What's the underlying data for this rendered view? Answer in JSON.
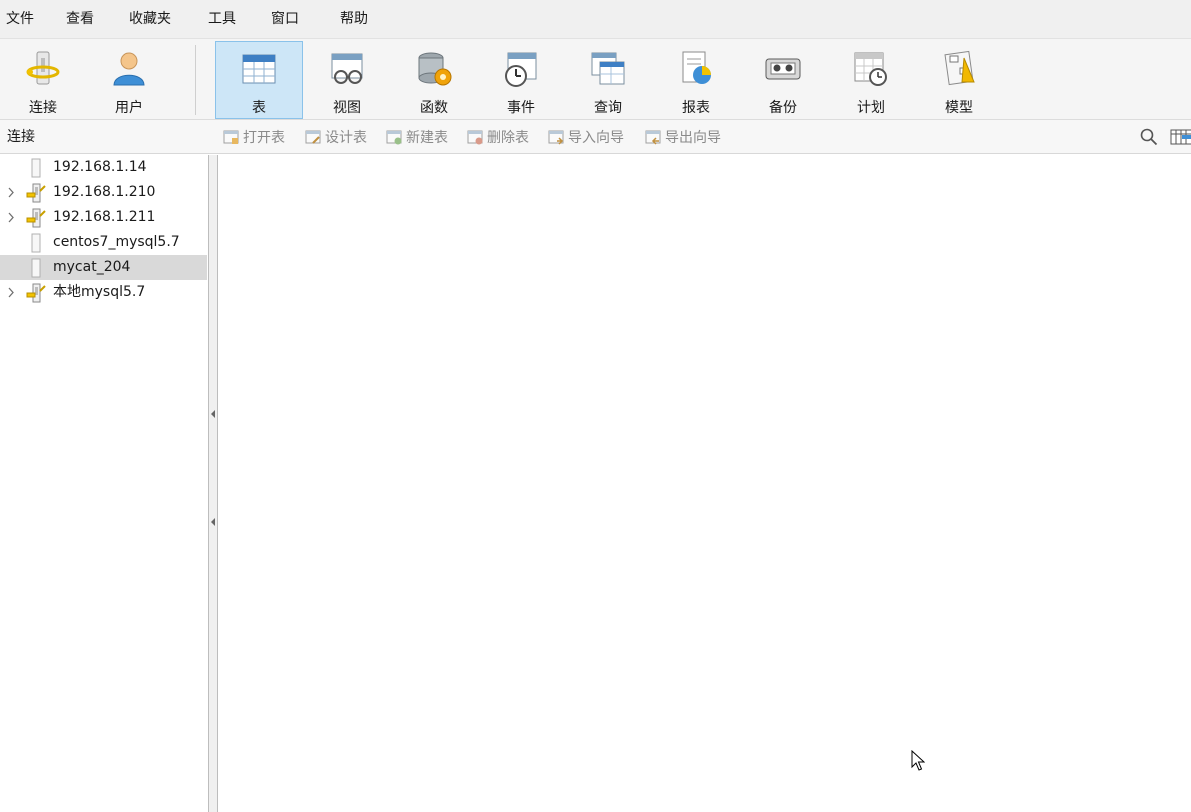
{
  "menu": [
    "文件",
    "查看",
    "收藏夹",
    "工具",
    "窗口",
    "帮助"
  ],
  "toolbar": [
    {
      "label": "连接",
      "icon": "connection-icon"
    },
    {
      "label": "用户",
      "icon": "user-icon"
    },
    {
      "label": "表",
      "icon": "table-icon",
      "active": true
    },
    {
      "label": "视图",
      "icon": "view-icon"
    },
    {
      "label": "函数",
      "icon": "function-icon"
    },
    {
      "label": "事件",
      "icon": "event-icon"
    },
    {
      "label": "查询",
      "icon": "query-icon"
    },
    {
      "label": "报表",
      "icon": "report-icon"
    },
    {
      "label": "备份",
      "icon": "backup-icon"
    },
    {
      "label": "计划",
      "icon": "schedule-icon"
    },
    {
      "label": "模型",
      "icon": "model-icon"
    }
  ],
  "sidebar": {
    "title": "连接",
    "connections": [
      {
        "name": "192.168.1.14",
        "expandable": false,
        "connected": false
      },
      {
        "name": "192.168.1.210",
        "expandable": true,
        "connected": true
      },
      {
        "name": "192.168.1.211",
        "expandable": true,
        "connected": true
      },
      {
        "name": "centos7_mysql5.7",
        "expandable": false,
        "connected": false
      },
      {
        "name": "mycat_204",
        "expandable": false,
        "connected": false,
        "selected": true
      },
      {
        "name": "本地mysql5.7",
        "expandable": true,
        "connected": true
      }
    ]
  },
  "actions": [
    "打开表",
    "设计表",
    "新建表",
    "删除表",
    "导入向导",
    "导出向导"
  ],
  "colors": {
    "active_toolbar_bg": "#cde6f7",
    "active_toolbar_border": "#8ac2ea",
    "selected_row": "#d9d9d9"
  }
}
